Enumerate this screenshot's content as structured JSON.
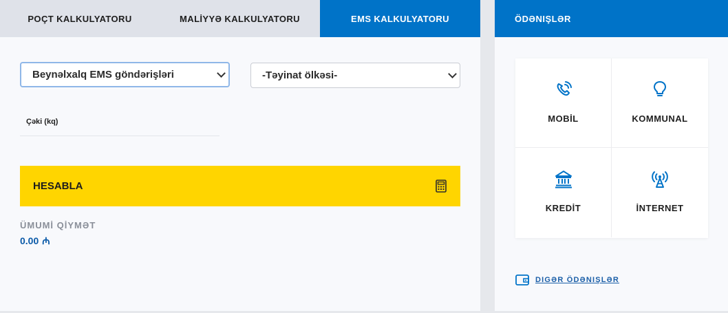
{
  "tabs": {
    "post_calc": "POÇT KALKULYATORU",
    "finance_calc": "MALİYYƏ KALKULYATORU",
    "ems_calc": "EMS KALKULYATORU"
  },
  "form": {
    "shipment_type": "Beynəlxalq EMS göndərişləri",
    "destination_country": "-Təyinat ölkəsi-",
    "weight_label": "Çəki (kq)",
    "calculate_label": "HESABLA"
  },
  "total": {
    "label": "ÜMUMİ QİYMƏT",
    "value": "0.00",
    "currency": "₼"
  },
  "payments": {
    "title": "Ödənişlər",
    "items": [
      {
        "label": "MOBİL",
        "icon": "phone-icon"
      },
      {
        "label": "KOMMUNAL",
        "icon": "lightbulb-icon"
      },
      {
        "label": "KREDİT",
        "icon": "bank-icon"
      },
      {
        "label": "İNTERNET",
        "icon": "antenna-icon"
      }
    ],
    "other_label": "Digər ödənişlər"
  },
  "colors": {
    "accent": "#0073c8",
    "button": "#ffd500",
    "total_value": "#0b5aa8"
  }
}
